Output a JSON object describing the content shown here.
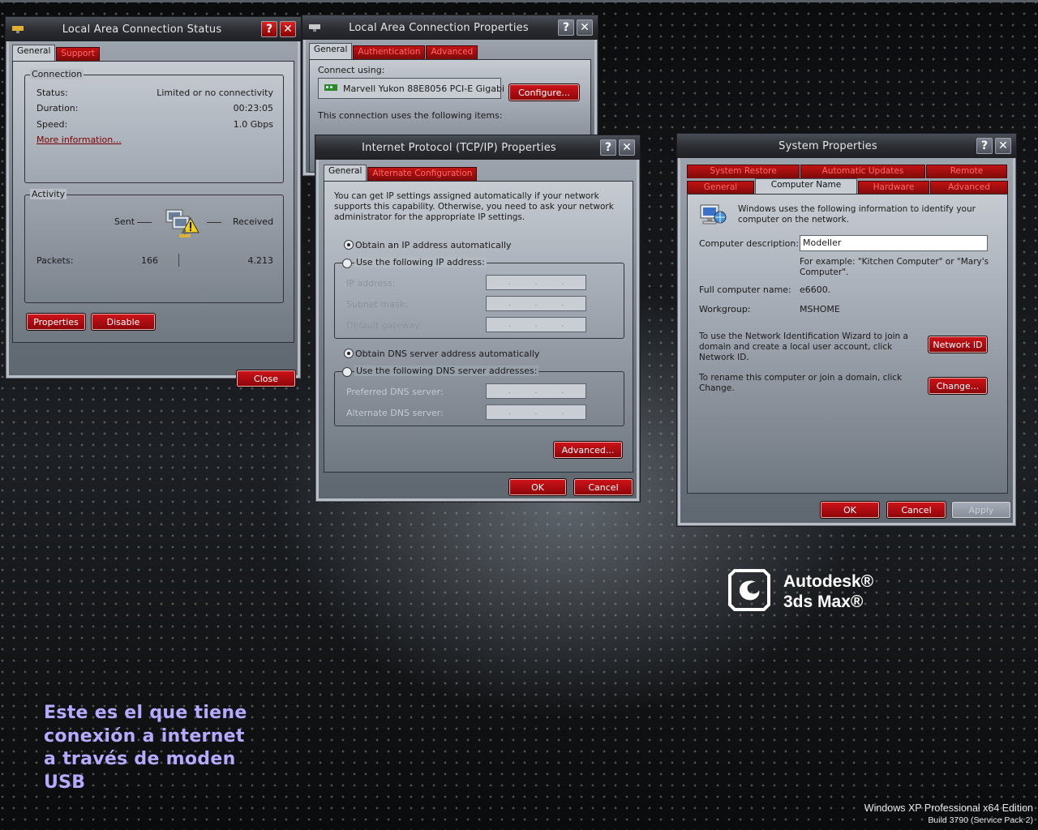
{
  "colors": {
    "accent": "#c21212",
    "dialog_bg": "#b9bec6",
    "title_bg": "#2a2c31"
  },
  "status_window": {
    "title": "Local Area Connection Status",
    "tabs": [
      "General",
      "Support"
    ],
    "connection": {
      "title": "Connection",
      "status_label": "Status:",
      "status_value": "Limited or no connectivity",
      "duration_label": "Duration:",
      "duration_value": "00:23:05",
      "speed_label": "Speed:",
      "speed_value": "1.0 Gbps",
      "more_info": "More information..."
    },
    "activity": {
      "title": "Activity",
      "sent": "Sent",
      "received": "Received",
      "packets_label": "Packets:",
      "sent_packets": "166",
      "received_packets": "4.213"
    },
    "buttons": {
      "properties": "Properties",
      "disable": "Disable",
      "close": "Close"
    }
  },
  "properties_window": {
    "title": "Local Area Connection Properties",
    "tabs": [
      "General",
      "Authentication",
      "Advanced"
    ],
    "connect_using": "Connect using:",
    "adapter": "Marvell Yukon 88E8056 PCI-E Gigabi",
    "configure": "Configure...",
    "items_label": "This connection uses the following items:"
  },
  "tcpip_window": {
    "title": "Internet Protocol (TCP/IP) Properties",
    "tabs": [
      "General",
      "Alternate Configuration"
    ],
    "description": "You can get IP settings assigned automatically if your network supports this capability. Otherwise, you need to ask your network administrator for the appropriate IP settings.",
    "obtain_ip": "Obtain an IP address automatically",
    "use_ip": "Use the following IP address:",
    "ip_address": "IP address:",
    "subnet_mask": "Subnet mask:",
    "default_gateway": "Default gateway:",
    "obtain_dns": "Obtain DNS server address automatically",
    "use_dns": "Use the following DNS server addresses:",
    "preferred_dns": "Preferred DNS server:",
    "alternate_dns": "Alternate DNS server:",
    "advanced": "Advanced...",
    "ok": "OK",
    "cancel": "Cancel"
  },
  "sysprop_window": {
    "title": "System Properties",
    "tabs_row1": [
      "System Restore",
      "Automatic Updates",
      "Remote"
    ],
    "tabs_row2": [
      "General",
      "Computer Name",
      "Hardware",
      "Advanced"
    ],
    "intro": "Windows uses the following information to identify your computer on the network.",
    "desc_label": "Computer description:",
    "desc_value": "Modeller",
    "example": "For example: \"Kitchen Computer\" or \"Mary's Computer\".",
    "full_name_label": "Full computer name:",
    "full_name_value": "e6600.",
    "workgroup_label": "Workgroup:",
    "workgroup_value": "MSHOME",
    "wizard_text": "To use the Network Identification Wizard to join a domain and create a local user account, click Network ID.",
    "network_id": "Network ID",
    "rename_text": "To rename this computer or join a domain, click Change.",
    "change": "Change...",
    "ok": "OK",
    "cancel": "Cancel",
    "apply": "Apply"
  },
  "desktop": {
    "overlay_lines": [
      "Este es el que tiene",
      "conexión a internet",
      "a través de moden",
      "USB"
    ],
    "brand_line1": "Autodesk®",
    "brand_line2": "3ds Max®",
    "os_name": "Windows XP Professional x64 Edition",
    "os_build": "Build 3790 (Service Pack 2)"
  }
}
